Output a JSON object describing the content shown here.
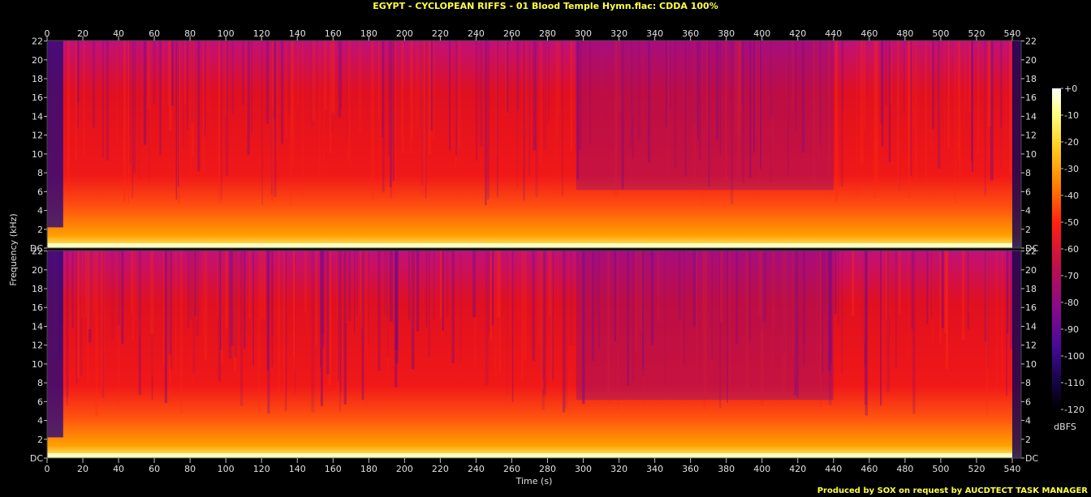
{
  "header": {
    "title": "EGYPT - CYCLOPEAN RIFFS - 01 Blood Temple Hymn.flac: CDDA 100%"
  },
  "footer": {
    "text": "Produced by SOX on request by AUCDTECT TASK MANAGER"
  },
  "chart_data": {
    "type": "heatmap",
    "title": "EGYPT - CYCLOPEAN RIFFS - 01 Blood Temple Hymn.flac: CDDA 100%",
    "xlabel": "Time (s)",
    "ylabel": "Frequency (kHz)",
    "xlim": [
      0,
      545
    ],
    "ylim": [
      0,
      22.05
    ],
    "x_ticks": [
      "0",
      "20",
      "40",
      "60",
      "80",
      "100",
      "120",
      "140",
      "160",
      "180",
      "200",
      "220",
      "240",
      "260",
      "280",
      "300",
      "320",
      "340",
      "360",
      "380",
      "400",
      "420",
      "440",
      "460",
      "480",
      "500",
      "520",
      "540"
    ],
    "y_ticks": [
      "DC",
      "2",
      "4",
      "6",
      "8",
      "10",
      "12",
      "14",
      "16",
      "18",
      "20",
      "22"
    ],
    "channels": 2,
    "colorbar": {
      "label": "dBFS",
      "ticks": [
        "+0",
        "-10",
        "-20",
        "-30",
        "-40",
        "-50",
        "-60",
        "-70",
        "-80",
        "-90",
        "-100",
        "-110",
        "-120"
      ],
      "range": [
        -120,
        0
      ]
    },
    "colorscale": [
      "#000000",
      "#0a0030",
      "#3a0a7a",
      "#7a0a9a",
      "#b0106a",
      "#e01020",
      "#ff3010",
      "#ff7000",
      "#ffb000",
      "#ffe040",
      "#ffffc0",
      "#ffffff"
    ]
  }
}
